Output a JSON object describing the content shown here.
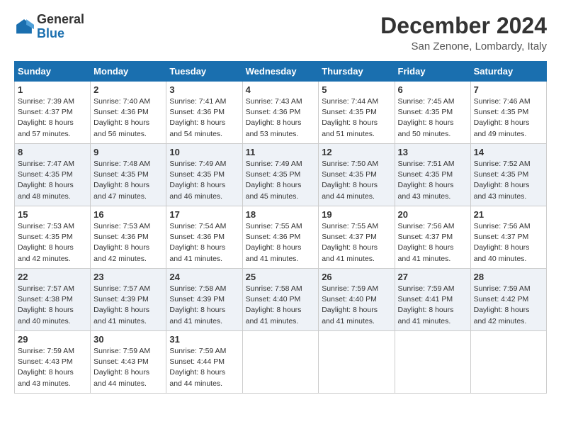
{
  "logo": {
    "general": "General",
    "blue": "Blue"
  },
  "title": "December 2024",
  "location": "San Zenone, Lombardy, Italy",
  "weekdays": [
    "Sunday",
    "Monday",
    "Tuesday",
    "Wednesday",
    "Thursday",
    "Friday",
    "Saturday"
  ],
  "weeks": [
    [
      {
        "day": "1",
        "sunrise": "7:39 AM",
        "sunset": "4:37 PM",
        "daylight": "8 hours and 57 minutes."
      },
      {
        "day": "2",
        "sunrise": "7:40 AM",
        "sunset": "4:36 PM",
        "daylight": "8 hours and 56 minutes."
      },
      {
        "day": "3",
        "sunrise": "7:41 AM",
        "sunset": "4:36 PM",
        "daylight": "8 hours and 54 minutes."
      },
      {
        "day": "4",
        "sunrise": "7:43 AM",
        "sunset": "4:36 PM",
        "daylight": "8 hours and 53 minutes."
      },
      {
        "day": "5",
        "sunrise": "7:44 AM",
        "sunset": "4:35 PM",
        "daylight": "8 hours and 51 minutes."
      },
      {
        "day": "6",
        "sunrise": "7:45 AM",
        "sunset": "4:35 PM",
        "daylight": "8 hours and 50 minutes."
      },
      {
        "day": "7",
        "sunrise": "7:46 AM",
        "sunset": "4:35 PM",
        "daylight": "8 hours and 49 minutes."
      }
    ],
    [
      {
        "day": "8",
        "sunrise": "7:47 AM",
        "sunset": "4:35 PM",
        "daylight": "8 hours and 48 minutes."
      },
      {
        "day": "9",
        "sunrise": "7:48 AM",
        "sunset": "4:35 PM",
        "daylight": "8 hours and 47 minutes."
      },
      {
        "day": "10",
        "sunrise": "7:49 AM",
        "sunset": "4:35 PM",
        "daylight": "8 hours and 46 minutes."
      },
      {
        "day": "11",
        "sunrise": "7:49 AM",
        "sunset": "4:35 PM",
        "daylight": "8 hours and 45 minutes."
      },
      {
        "day": "12",
        "sunrise": "7:50 AM",
        "sunset": "4:35 PM",
        "daylight": "8 hours and 44 minutes."
      },
      {
        "day": "13",
        "sunrise": "7:51 AM",
        "sunset": "4:35 PM",
        "daylight": "8 hours and 43 minutes."
      },
      {
        "day": "14",
        "sunrise": "7:52 AM",
        "sunset": "4:35 PM",
        "daylight": "8 hours and 43 minutes."
      }
    ],
    [
      {
        "day": "15",
        "sunrise": "7:53 AM",
        "sunset": "4:35 PM",
        "daylight": "8 hours and 42 minutes."
      },
      {
        "day": "16",
        "sunrise": "7:53 AM",
        "sunset": "4:36 PM",
        "daylight": "8 hours and 42 minutes."
      },
      {
        "day": "17",
        "sunrise": "7:54 AM",
        "sunset": "4:36 PM",
        "daylight": "8 hours and 41 minutes."
      },
      {
        "day": "18",
        "sunrise": "7:55 AM",
        "sunset": "4:36 PM",
        "daylight": "8 hours and 41 minutes."
      },
      {
        "day": "19",
        "sunrise": "7:55 AM",
        "sunset": "4:37 PM",
        "daylight": "8 hours and 41 minutes."
      },
      {
        "day": "20",
        "sunrise": "7:56 AM",
        "sunset": "4:37 PM",
        "daylight": "8 hours and 41 minutes."
      },
      {
        "day": "21",
        "sunrise": "7:56 AM",
        "sunset": "4:37 PM",
        "daylight": "8 hours and 40 minutes."
      }
    ],
    [
      {
        "day": "22",
        "sunrise": "7:57 AM",
        "sunset": "4:38 PM",
        "daylight": "8 hours and 40 minutes."
      },
      {
        "day": "23",
        "sunrise": "7:57 AM",
        "sunset": "4:39 PM",
        "daylight": "8 hours and 41 minutes."
      },
      {
        "day": "24",
        "sunrise": "7:58 AM",
        "sunset": "4:39 PM",
        "daylight": "8 hours and 41 minutes."
      },
      {
        "day": "25",
        "sunrise": "7:58 AM",
        "sunset": "4:40 PM",
        "daylight": "8 hours and 41 minutes."
      },
      {
        "day": "26",
        "sunrise": "7:59 AM",
        "sunset": "4:40 PM",
        "daylight": "8 hours and 41 minutes."
      },
      {
        "day": "27",
        "sunrise": "7:59 AM",
        "sunset": "4:41 PM",
        "daylight": "8 hours and 41 minutes."
      },
      {
        "day": "28",
        "sunrise": "7:59 AM",
        "sunset": "4:42 PM",
        "daylight": "8 hours and 42 minutes."
      }
    ],
    [
      {
        "day": "29",
        "sunrise": "7:59 AM",
        "sunset": "4:43 PM",
        "daylight": "8 hours and 43 minutes."
      },
      {
        "day": "30",
        "sunrise": "7:59 AM",
        "sunset": "4:43 PM",
        "daylight": "8 hours and 44 minutes."
      },
      {
        "day": "31",
        "sunrise": "7:59 AM",
        "sunset": "4:44 PM",
        "daylight": "8 hours and 44 minutes."
      },
      null,
      null,
      null,
      null
    ]
  ]
}
